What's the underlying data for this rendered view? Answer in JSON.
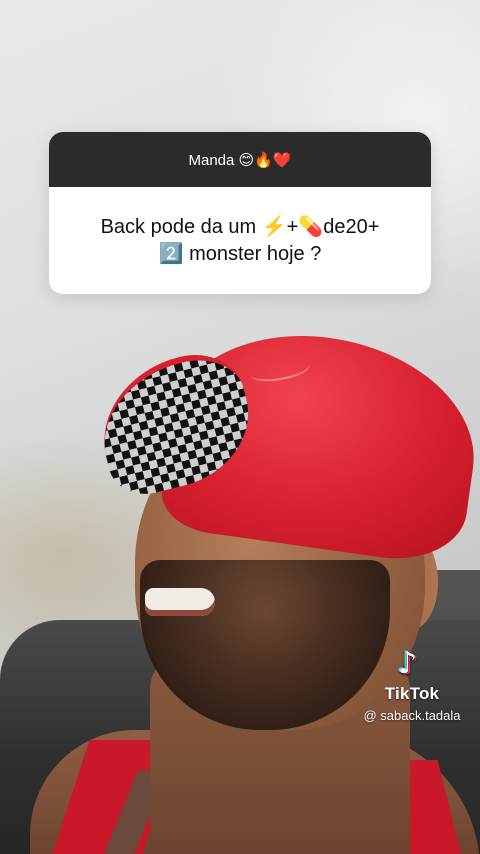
{
  "question_sticker": {
    "header": "Manda 😊🔥❤️",
    "question_line1": "Back pode da um ⚡️+💊de20+",
    "question_line2": "2️⃣ monster hoje ?"
  },
  "watermark": {
    "logo_glyph": "♪",
    "brand": "TikTok",
    "username": "@ saback.tadala"
  },
  "colors": {
    "sticker_header_bg": "#2b2b2b",
    "sticker_body_bg": "#ffffff",
    "cap_red": "#d8202f",
    "tiktok_cyan": "#25f4ee",
    "tiktok_red": "#fe2c55"
  }
}
